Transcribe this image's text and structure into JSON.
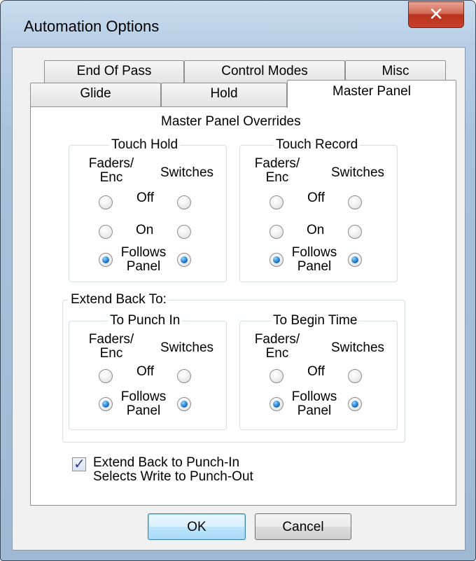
{
  "window": {
    "title": "Automation Options",
    "close_glyph": "✕"
  },
  "tabs": {
    "row_back": [
      "End Of Pass",
      "Control Modes",
      "Misc"
    ],
    "row_front": [
      "Glide",
      "Hold",
      "Master Panel"
    ]
  },
  "panel": {
    "heading": "Master Panel Overrides",
    "touch_hold": {
      "title": "Touch Hold",
      "col_left": [
        "Faders/",
        "Enc"
      ],
      "col_right": "Switches",
      "rows": [
        "Off",
        "On",
        "Follows",
        "Panel"
      ],
      "selected": "Follows Panel"
    },
    "touch_record": {
      "title": "Touch Record",
      "col_left": [
        "Faders/",
        "Enc"
      ],
      "col_right": "Switches",
      "rows": [
        "Off",
        "On",
        "Follows",
        "Panel"
      ],
      "selected": "Follows Panel"
    },
    "extend_back": {
      "title": "Extend Back To:",
      "to_punch_in": {
        "title": "To Punch In",
        "col_left": [
          "Faders/",
          "Enc"
        ],
        "col_right": "Switches",
        "rows": [
          "Off",
          "Follows",
          "Panel"
        ],
        "selected": "Follows Panel"
      },
      "to_begin_time": {
        "title": "To Begin Time",
        "col_left": [
          "Faders/",
          "Enc"
        ],
        "col_right": "Switches",
        "rows": [
          "Off",
          "Follows",
          "Panel"
        ],
        "selected": "Follows Panel"
      }
    },
    "checkbox": {
      "checked": true,
      "mark": "✓",
      "label_line1": "Extend Back to Punch-In",
      "label_line2": "Selects Write to Punch-Out"
    }
  },
  "buttons": {
    "ok": "OK",
    "cancel": "Cancel"
  }
}
